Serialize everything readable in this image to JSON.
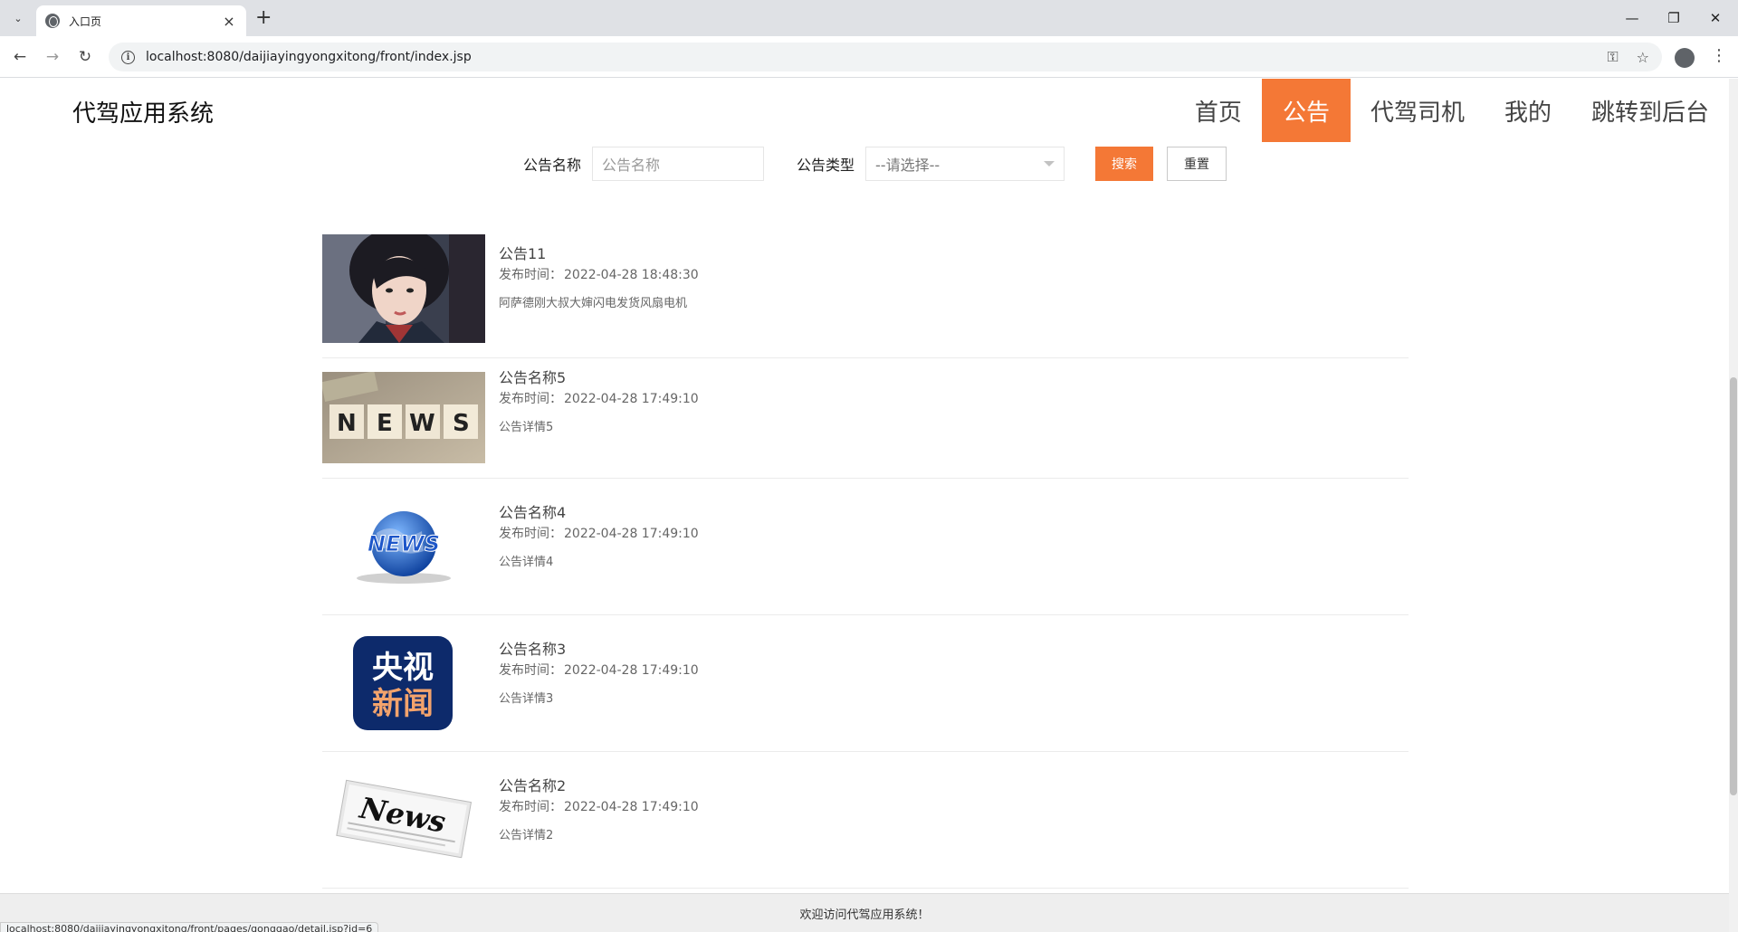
{
  "browser": {
    "tab_title": "入口页",
    "url": "localhost:8080/daijiayingyongxitong/front/index.jsp",
    "status_url": "localhost:8080/daijiayingyongxitong/front/pages/gonggao/detail.jsp?id=6"
  },
  "header": {
    "brand": "代驾应用系统",
    "menu": [
      {
        "label": "首页",
        "active": false
      },
      {
        "label": "公告",
        "active": true
      },
      {
        "label": "代驾司机",
        "active": false
      },
      {
        "label": "我的",
        "active": false
      },
      {
        "label": "跳转到后台",
        "active": false
      }
    ]
  },
  "search": {
    "name_label": "公告名称",
    "name_placeholder": "公告名称",
    "type_label": "公告类型",
    "type_selected": "--请选择--",
    "search_button": "搜索",
    "reset_button": "重置"
  },
  "news": [
    {
      "title": "公告11",
      "time_label": "发布时间：",
      "time": "2022-04-28 18:48:30",
      "desc": "阿萨德刚大叔大婶闪电发货风扇电机",
      "image": "girl-portrait"
    },
    {
      "title": "公告名称5",
      "time_label": "发布时间：",
      "time": "2022-04-28 17:49:10",
      "desc": "公告详情5",
      "image": "news-dice"
    },
    {
      "title": "公告名称4",
      "time_label": "发布时间：",
      "time": "2022-04-28 17:49:10",
      "desc": "公告详情4",
      "image": "news-globe"
    },
    {
      "title": "公告名称3",
      "time_label": "发布时间：",
      "time": "2022-04-28 17:49:10",
      "desc": "公告详情3",
      "image": "cctv-news-logo",
      "logo_text": "央视新闻"
    },
    {
      "title": "公告名称2",
      "time_label": "发布时间：",
      "time": "2022-04-28 17:49:10",
      "desc": "公告详情2",
      "image": "newspaper"
    }
  ],
  "image_text": {
    "dice_letters": [
      "N",
      "E",
      "W",
      "S"
    ],
    "globe_word": "NEWS",
    "newspaper_word": "News",
    "cctv_line1": "央视",
    "cctv_line2": "新闻"
  },
  "footer": {
    "text": "欢迎访问代驾应用系统！"
  },
  "colors": {
    "accent": "#f47836"
  }
}
